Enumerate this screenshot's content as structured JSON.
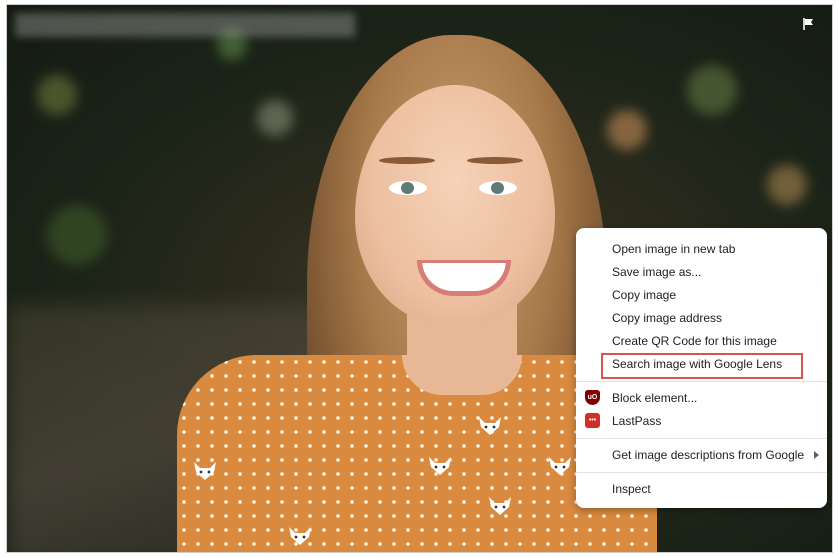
{
  "icons": {
    "flag": "flag-icon",
    "ublock": "ublock-origin-icon",
    "lastpass": "lastpass-icon",
    "submenu": "chevron-right-icon"
  },
  "colors": {
    "highlight_border": "#d9534f",
    "menu_bg": "#ffffff",
    "menu_text": "#202124"
  },
  "context_menu": {
    "items": [
      {
        "label": "Open image in new tab"
      },
      {
        "label": "Save image as..."
      },
      {
        "label": "Copy image"
      },
      {
        "label": "Copy image address"
      },
      {
        "label": "Create QR Code for this image"
      },
      {
        "label": "Search image with Google Lens",
        "highlighted": true
      }
    ],
    "extensions": [
      {
        "label": "Block element..."
      },
      {
        "label": "LastPass"
      }
    ],
    "descriptions": {
      "label": "Get image descriptions from Google"
    },
    "inspect": {
      "label": "Inspect"
    }
  }
}
